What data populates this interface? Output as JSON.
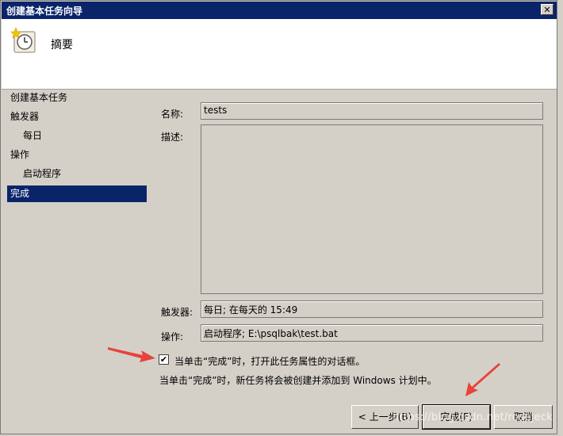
{
  "window": {
    "title": "创建基本任务向导",
    "close_label": "✕"
  },
  "header": {
    "title": "摘要",
    "icon": "task-clock-icon"
  },
  "nav": {
    "items": [
      {
        "label": "创建基本任务",
        "level": 0,
        "selected": false
      },
      {
        "label": "触发器",
        "level": 0,
        "selected": false
      },
      {
        "label": "每日",
        "level": 1,
        "selected": false
      },
      {
        "label": "操作",
        "level": 0,
        "selected": false
      },
      {
        "label": "启动程序",
        "level": 1,
        "selected": false
      },
      {
        "label": "完成",
        "level": 0,
        "selected": true
      }
    ]
  },
  "form": {
    "name_label": "名称:",
    "name_value": "tests",
    "desc_label": "描述:",
    "desc_value": "",
    "trigger_label": "触发器:",
    "trigger_value": "每日; 在每天的 15:49",
    "action_label": "操作:",
    "action_value": "启动程序; E:\\psqlbak\\test.bat"
  },
  "footer": {
    "checkbox_checked": true,
    "checkbox_label": "当单击“完成”时，打开此任务属性的对话框。",
    "info_text": "当单击“完成”时，新任务将会被创建并添加到 Windows 计划中。",
    "back_label": "< 上一步(B)",
    "finish_label": "完成(F)",
    "cancel_label": "取消"
  },
  "watermark": "https://blog.csdn.net/rosejeck",
  "colors": {
    "selected": "#0a246a",
    "arrow": "#e8423a",
    "dialog": "#d4d0c8"
  }
}
